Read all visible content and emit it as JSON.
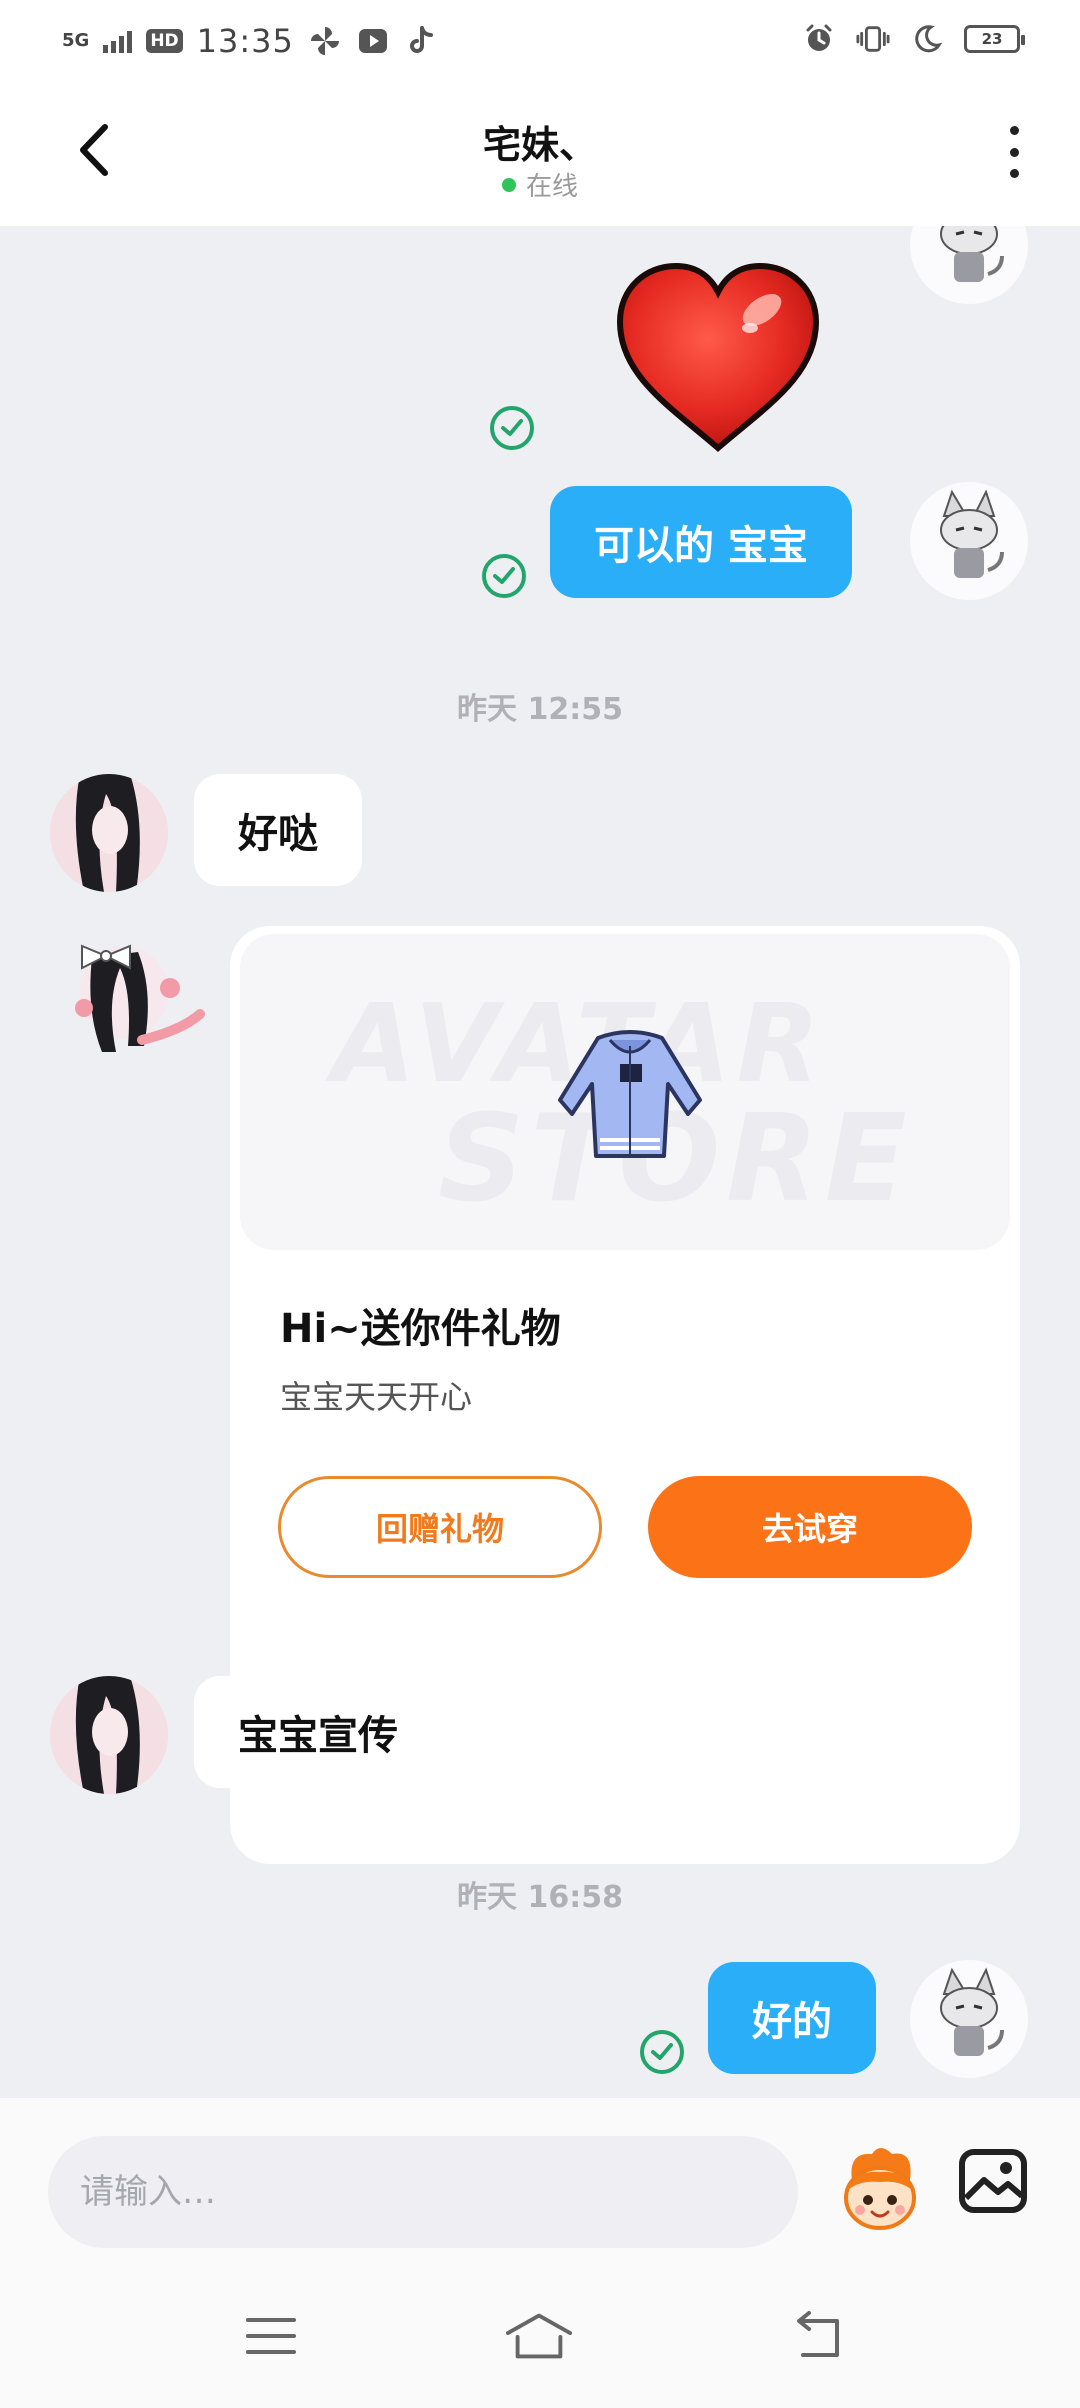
{
  "status_bar": {
    "network": "5G",
    "hd": "HD",
    "time": "13:35",
    "battery": "23"
  },
  "header": {
    "title": "宅妹、",
    "status": "在线",
    "status_color": "#2fc55a"
  },
  "messages": {
    "m1": {
      "text": "可以的 宝宝"
    },
    "ts1": "昨天 12:55",
    "m2": {
      "text": "好哒"
    },
    "gift": {
      "watermark_1": "AVATAR",
      "watermark_2": "STORE",
      "title": "Hi~送你件礼物",
      "subtitle": "宝宝天天开心",
      "return_label": "回赠礼物",
      "try_label": "去试穿"
    },
    "m3": {
      "text": "宝宝宣传"
    },
    "ts2": "昨天 16:58",
    "m4": {
      "text": "好的"
    }
  },
  "input": {
    "placeholder": "请输入…"
  },
  "colors": {
    "outgoing_bubble": "#2aaef7",
    "sent_check": "#22a56b",
    "accent_orange": "#fb7316"
  },
  "icons": {
    "back": "back-arrow-icon",
    "more": "more-vertical-icon",
    "emoji": "emoji-mascot-icon",
    "image": "image-icon",
    "menu": "menu-icon",
    "home": "home-icon",
    "return": "return-icon"
  }
}
